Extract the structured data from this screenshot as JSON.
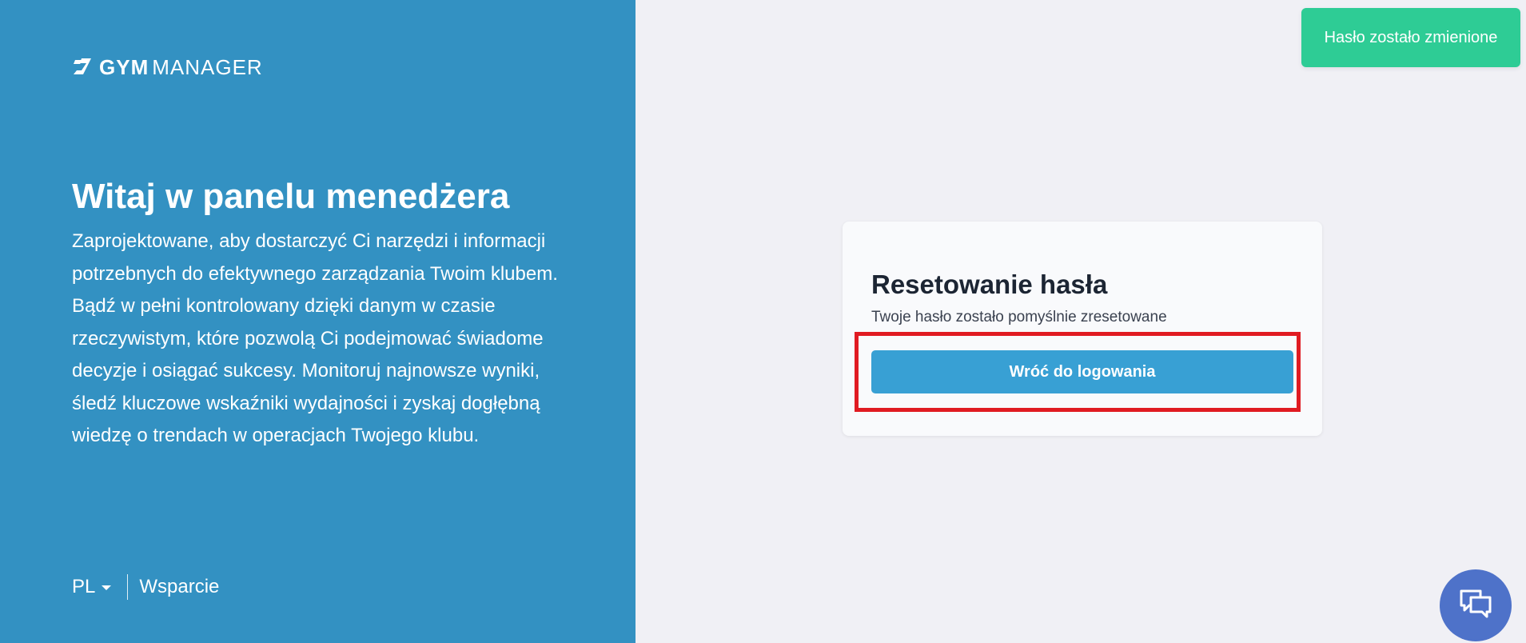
{
  "brand": {
    "logo_bold": "GYM",
    "logo_light": "MANAGER"
  },
  "welcome": {
    "title": "Witaj w panelu menedżera",
    "text": "Zaprojektowane, aby dostarczyć Ci narzędzi i informacji potrzebnych do efektywnego zarządzania Twoim klubem. Bądź w pełni kontrolowany dzięki danym w czasie rzeczywistym, które pozwolą Ci podejmować świadome decyzje i osiągać sukcesy. Monitoruj najnowsze wyniki, śledź kluczowe wskaźniki wydajności i zyskaj dogłębną wiedzę o trendach w operacjach Twojego klubu."
  },
  "footer": {
    "language": "PL",
    "support": "Wsparcie"
  },
  "toast": {
    "message": "Hasło zostało zmienione"
  },
  "reset_card": {
    "title": "Resetowanie hasła",
    "subtitle": "Twoje hasło zostało pomyślnie zresetowane",
    "button_label": "Wróć do logowania"
  },
  "colors": {
    "left_panel": "#3391c2",
    "background": "#f0f0f5",
    "toast": "#2ecc95",
    "button": "#38a0d4",
    "highlight": "#e01b22",
    "chat": "#4e72c9"
  },
  "icons": {
    "logo": "gym-manager-logo-icon",
    "language_caret": "caret-down-icon",
    "chat": "chat-bubbles-icon"
  }
}
